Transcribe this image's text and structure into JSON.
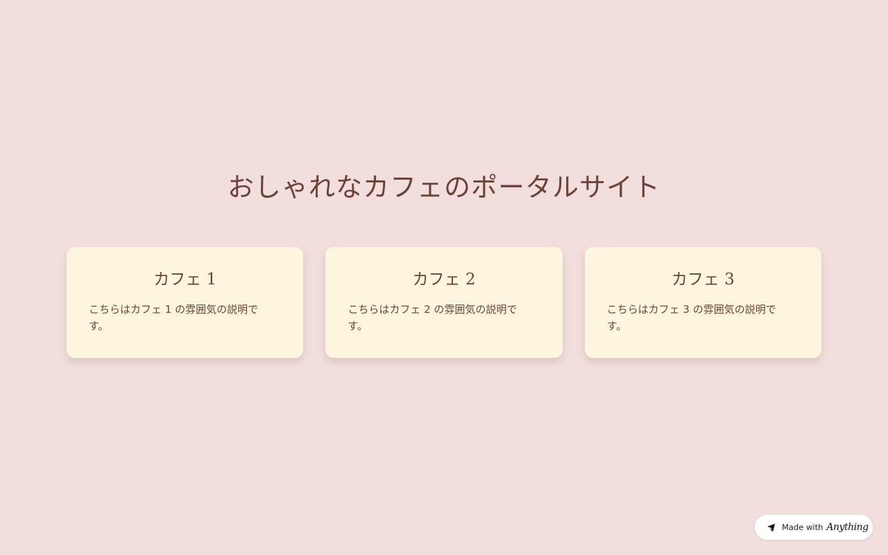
{
  "page": {
    "title": "おしゃれなカフェのポータルサイト",
    "background_color": "#f2dfdd",
    "text_color": "#6b4338",
    "card_color": "#fdf5de"
  },
  "cards": [
    {
      "title": "カフェ 1",
      "description": "こちらはカフェ 1 の雰囲気の説明です。"
    },
    {
      "title": "カフェ 2",
      "description": "こちらはカフェ 2 の雰囲気の説明です。"
    },
    {
      "title": "カフェ 3",
      "description": "こちらはカフェ 3 の雰囲気の説明です。"
    }
  ],
  "badge": {
    "made_with": "Made with",
    "brand": "Anything",
    "icon": "anything-logo-icon"
  }
}
